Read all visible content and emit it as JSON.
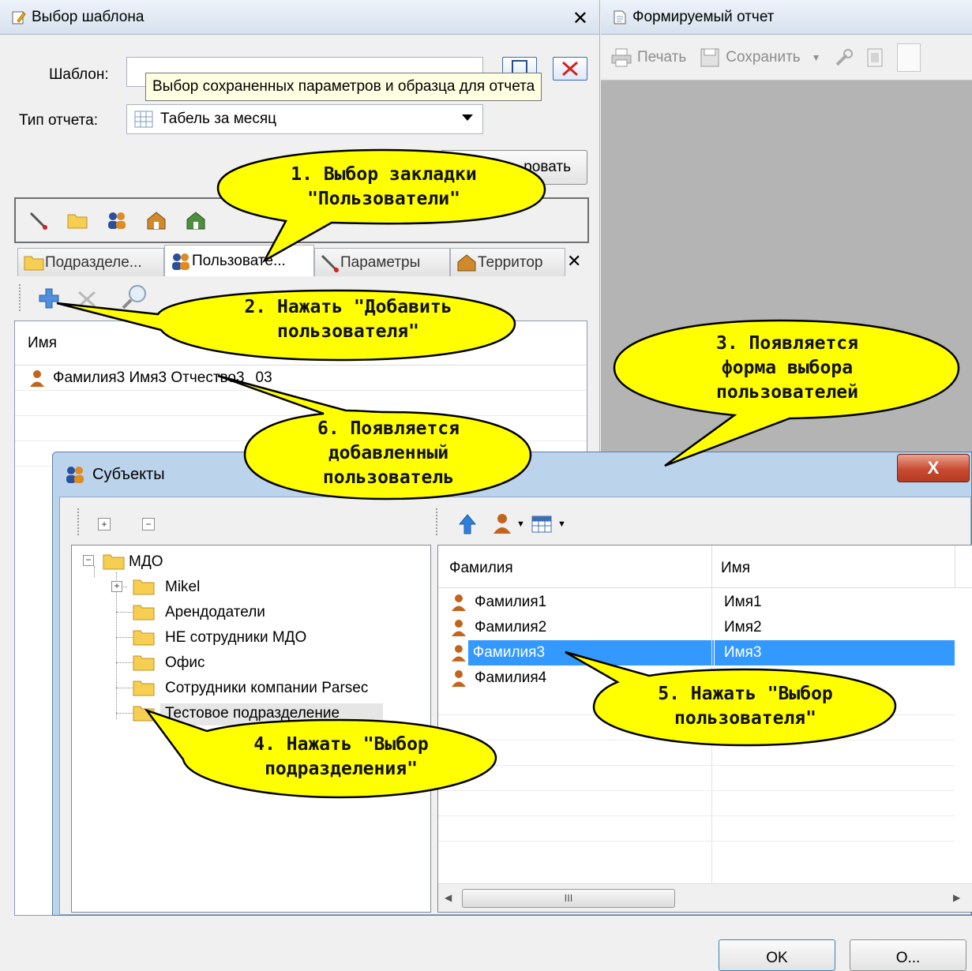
{
  "left_panel": {
    "title": "Выбор шаблона",
    "template_label": "Шаблон:",
    "template_value": "",
    "report_type_label": "Тип отчета:",
    "report_type_value": "Табель за месяц",
    "tooltip": "Выбор сохраненных параметров и образца для отчета",
    "action_button_label": "...ровать",
    "tabs": [
      {
        "label": "Подразделе..."
      },
      {
        "label": "Пользовате...",
        "active": true
      },
      {
        "label": "Параметры"
      },
      {
        "label": "Территор"
      }
    ],
    "users_grid": {
      "column_name": "Имя",
      "rows": [
        {
          "name": "Фамилия3 Имя3 Отчество3",
          "code": "03"
        }
      ]
    }
  },
  "right_panel": {
    "title": "Формируемый отчет",
    "print_label": "Печать",
    "save_label": "Сохранить"
  },
  "dialog": {
    "title": "Субъекты",
    "close_label": "X",
    "tree": [
      {
        "label": "МДО"
      },
      {
        "label": "Mikel"
      },
      {
        "label": "Арендодатели"
      },
      {
        "label": "НЕ сотрудники МДО"
      },
      {
        "label": "Офис"
      },
      {
        "label": "Сотрудники компании Parsec"
      },
      {
        "label": "Тестовое подразделение"
      }
    ],
    "list": {
      "col_surname": "Фамилия",
      "col_name": "Имя",
      "rows": [
        {
          "surname": "Фамилия1",
          "name": "Имя1",
          "selected": false
        },
        {
          "surname": "Фамилия2",
          "name": "Имя2",
          "selected": false
        },
        {
          "surname": "Фамилия3",
          "name": "Имя3",
          "selected": true
        },
        {
          "surname": "Фамилия4",
          "name": "",
          "selected": false
        }
      ],
      "scroll_grip": "III"
    },
    "ok_label": "OK",
    "cancel_label": "O..."
  },
  "callouts": {
    "c1": "1. Выбор закладки\n\"Пользователи\"",
    "c2": "2. Нажать \"Добавить\nпользователя\"",
    "c3": "3. Появляется\nформа выбора\nпользователей",
    "c4": "4. Нажать \"Выбор\nподразделения\"",
    "c5": "5. Нажать \"Выбор\nпользователя\"",
    "c6": "6. Появляется\nдобавленный\nпользователь"
  },
  "colors": {
    "callout_fill": "#ffff00",
    "selection": "#3399ff",
    "dialog_frame": "#bcd3ec"
  }
}
